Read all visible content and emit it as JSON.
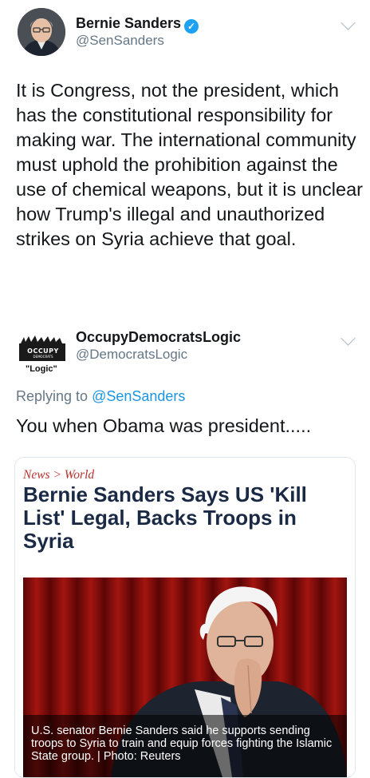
{
  "tweet": {
    "author_name": "Bernie Sanders",
    "handle": "@SenSanders",
    "body": "It is Congress, not the president, which has the constitutional responsibility for making war. The international community must uphold the prohibition against the use of chemical weapons, but it is unclear how Trump's illegal and unauthorized strikes on Syria achieve that goal."
  },
  "reply_tweet": {
    "author_name": "OccupyDemocratsLogic",
    "handle": "@DemocratsLogic",
    "avatar_text": {
      "top": "OCCUPY",
      "sub": "DEMOCRATS",
      "bottom": "\"Logic\""
    },
    "replying_prefix": "Replying to ",
    "replying_mention": "@SenSanders",
    "body": "You when Obama was president....."
  },
  "card": {
    "breadcrumb": "News > World",
    "headline": "Bernie Sanders Says US 'Kill List' Legal, Backs Troops in Syria",
    "caption": "U.S. senator Bernie Sanders said he supports sending troops to Syria to train and equip forces fighting the Islamic State group. | Photo: Reuters"
  },
  "icons": [
    "verified-badge-icon",
    "chevron-down-icon"
  ],
  "colors": {
    "link": "#1b95e0",
    "verified": "#1da1f2",
    "secondary_text": "#657786",
    "breadcrumb": "#b9322b",
    "headline": "#1a2a45",
    "photo_bg": "#7a0a0a"
  }
}
